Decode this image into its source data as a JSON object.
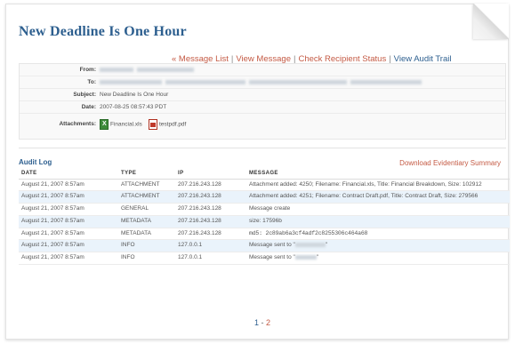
{
  "page": {
    "title": "New Deadline Is One Hour"
  },
  "nav": {
    "message_list": "« Message List",
    "view_message": "View Message",
    "check_status": "Check Recipient Status",
    "view_audit": "View Audit Trail",
    "sep": "|"
  },
  "header": {
    "from_label": "From:",
    "to_label": "To:",
    "subject_label": "Subject:",
    "subject_value": "New Deadline Is One Hour",
    "date_label": "Date:",
    "date_value": "2007-08-25 08:57:43 PDT",
    "attachments_label": "Attachments:",
    "attachments": [
      {
        "name": "Financial.xls",
        "icon": "excel-file-icon"
      },
      {
        "name": "testpdf.pdf",
        "icon": "pdf-file-icon"
      }
    ]
  },
  "audit": {
    "title": "Audit Log",
    "download": "Download Evidentiary Summary",
    "columns": [
      "DATE",
      "TYPE",
      "IP",
      "MESSAGE"
    ],
    "rows": [
      {
        "date": "August 21, 2007 8:57am",
        "type": "ATTACHMENT",
        "ip": "207.216.243.128",
        "message": "Attachment added: 4250; Filename: Financial.xls, Title: Financial Breakdown, Size: 102912"
      },
      {
        "date": "August 21, 2007 8:57am",
        "type": "ATTACHMENT",
        "ip": "207.216.243.128",
        "message": "Attachment added: 4251; Filename: Contract Draft.pdf, Title: Contract Draft, Size: 279566"
      },
      {
        "date": "August 21, 2007 8:57am",
        "type": "GENERAL",
        "ip": "207.216.243.128",
        "message": "Message create"
      },
      {
        "date": "August 21, 2007 8:57am",
        "type": "METADATA",
        "ip": "207.216.243.128",
        "message": "size: 17596b"
      },
      {
        "date": "August 21, 2007 8:57am",
        "type": "METADATA",
        "ip": "207.216.243.128",
        "message": "md5: 2c89ab6a3cf4adf2c8255306c464a68"
      },
      {
        "date": "August 21, 2007 8:57am",
        "type": "INFO",
        "ip": "127.0.0.1",
        "message": "Message sent to \""
      },
      {
        "date": "August 21, 2007 8:57am",
        "type": "INFO",
        "ip": "127.0.0.1",
        "message": "Message sent to \""
      }
    ]
  },
  "pager": {
    "page1": "1",
    "dash": "-",
    "page2": "2"
  }
}
